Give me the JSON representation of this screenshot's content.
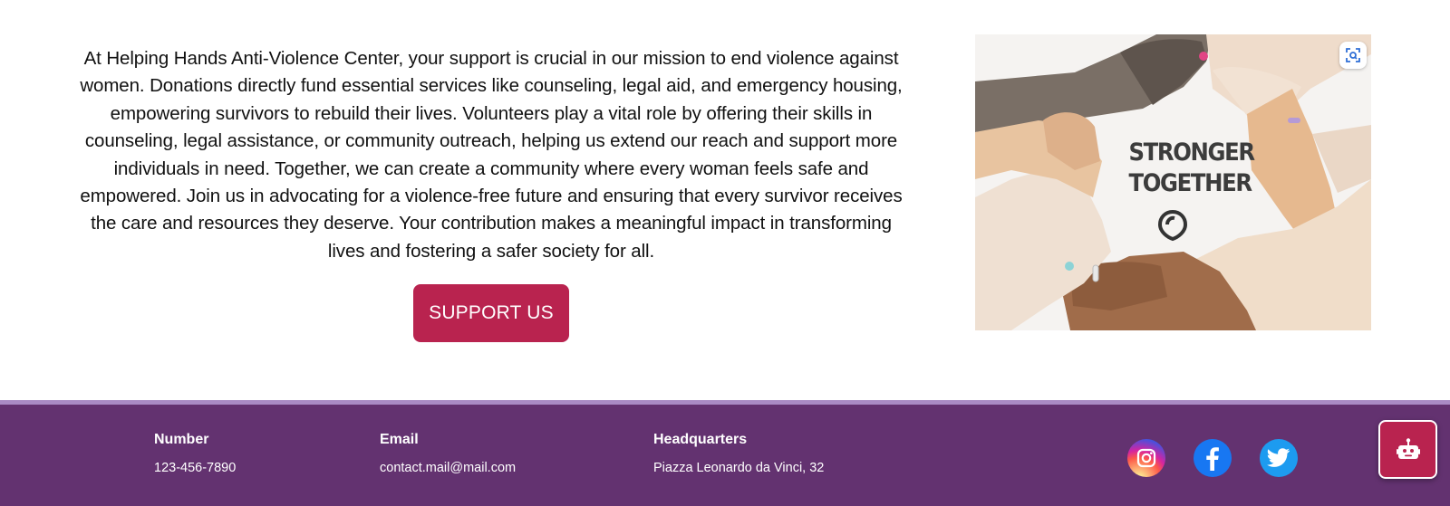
{
  "intro": {
    "paragraph": "At Helping Hands Anti-Violence Center, your support is crucial in our mission to end violence against women. Donations directly fund essential services like counseling, legal aid, and emergency housing, empowering survivors to rebuild their lives. Volunteers play a vital role by offering their skills in counseling, legal assistance, or community outreach, helping us extend our reach and support more individuals in need. Together, we can create a community where every woman feels safe and empowered. Join us in advocating for a violence-free future and ensuring that every survivor receives the care and resources they deserve. Your contribution makes a meaningful impact in transforming lives and fostering a safer society for all.",
    "support_button_label": "SUPPORT US"
  },
  "hero_image": {
    "caption_line1": "STRONGER",
    "caption_line2": "TOGETHER",
    "lens_icon": "visual-search-icon"
  },
  "footer": {
    "number_label": "Number",
    "number_value": "123-456-7890",
    "email_label": "Email",
    "email_value": "contact.mail@mail.com",
    "hq_label": "Headquarters",
    "hq_value": "Piazza Leonardo da Vinci, 32",
    "social_icons": [
      "instagram-icon",
      "facebook-icon",
      "twitter-icon"
    ]
  },
  "chat_widget": {
    "icon": "robot-icon"
  },
  "colors": {
    "accent": "#b9234f",
    "footer_bg": "#633270",
    "footer_stripe": "#a98bc4",
    "facebook": "#1877f2",
    "twitter": "#1d9bf0"
  }
}
